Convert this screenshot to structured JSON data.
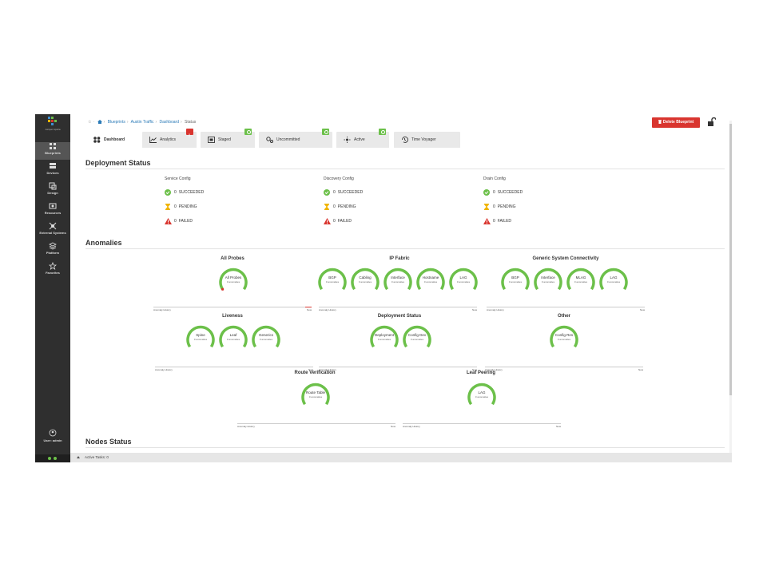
{
  "sidebar": {
    "brand": "Juniper Apstra",
    "items": [
      {
        "label": "Blueprints",
        "active": true
      },
      {
        "label": "Devices"
      },
      {
        "label": "Design"
      },
      {
        "label": "Resources"
      },
      {
        "label": "External Systems"
      },
      {
        "label": "Platform"
      },
      {
        "label": "Favorites"
      }
    ],
    "user": "User: admin"
  },
  "breadcrumb": {
    "home": "☆",
    "blueprints": "Blueprints",
    "blueprint": "Austin Traffic",
    "dashboard": "Dashboard",
    "current": "Status"
  },
  "header": {
    "delete_label": "Delete Blueprint"
  },
  "tabs": [
    {
      "label": "Dashboard",
      "icon": "dashboard-icon",
      "badge": ""
    },
    {
      "label": "Analytics",
      "icon": "analytics-icon",
      "badge": "red"
    },
    {
      "label": "Staged",
      "icon": "staged-icon",
      "badge": "green"
    },
    {
      "label": "Uncommitted",
      "icon": "uncommitted-icon",
      "badge": "green"
    },
    {
      "label": "Active",
      "icon": "active-icon",
      "badge": "green"
    },
    {
      "label": "Time Voyager",
      "icon": "time-voyager-icon",
      "badge": ""
    }
  ],
  "deployment": {
    "title": "Deployment Status",
    "columns": [
      {
        "title": "Service Config",
        "succeeded": "0",
        "pending": "0",
        "failed": "0"
      },
      {
        "title": "Discovery Config",
        "succeeded": "0",
        "pending": "0",
        "failed": "0"
      },
      {
        "title": "Drain Config",
        "succeeded": "0",
        "pending": "0",
        "failed": "0"
      }
    ],
    "labels": {
      "succeeded": "SUCCEEDED",
      "pending": "PENDING",
      "failed": "FAILED"
    }
  },
  "anomalies": {
    "title": "Anomalies",
    "anomalies_text": "0 anomalies",
    "history_label": "Anomaly History",
    "now_label": "Now",
    "groups": [
      {
        "title": "All Probes",
        "gauges": [
          "All Probes"
        ]
      },
      {
        "title": "IP Fabric",
        "gauges": [
          "BGP",
          "Cabling",
          "Interface",
          "Hostname",
          "LAG"
        ]
      },
      {
        "title": "Generic System Connectivity",
        "gauges": [
          "BGP",
          "Interface",
          "MLAG",
          "LAG"
        ]
      },
      {
        "title": "Liveness",
        "gauges": [
          "Spine",
          "Leaf",
          "Generics"
        ]
      },
      {
        "title": "Deployment Status",
        "gauges": [
          "Deployment",
          "Config Dev"
        ]
      },
      {
        "title": "Other",
        "gauges": [
          "Config Res"
        ]
      },
      {
        "title": "Route Verification",
        "gauges": [
          "Route Table"
        ]
      },
      {
        "title": "Leaf Peering",
        "gauges": [
          "LAG"
        ]
      }
    ]
  },
  "nodes": {
    "title": "Nodes Status"
  },
  "footer": {
    "active_tasks": "Active Tasks: 0"
  },
  "colors": {
    "ok": "#6cc04a",
    "warn": "#f0b400",
    "error": "#d9352f"
  }
}
